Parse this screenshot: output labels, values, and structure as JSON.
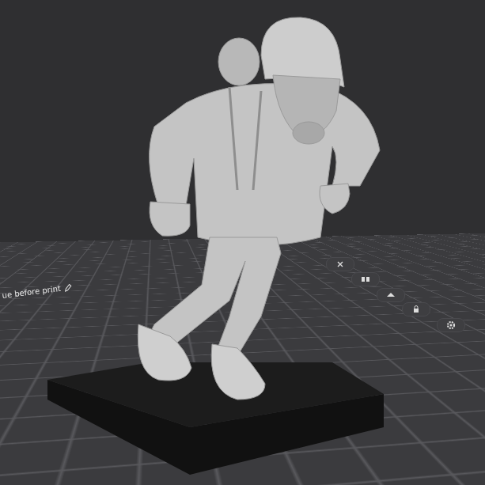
{
  "viewport": {
    "plate_label": "ue before print"
  }
}
